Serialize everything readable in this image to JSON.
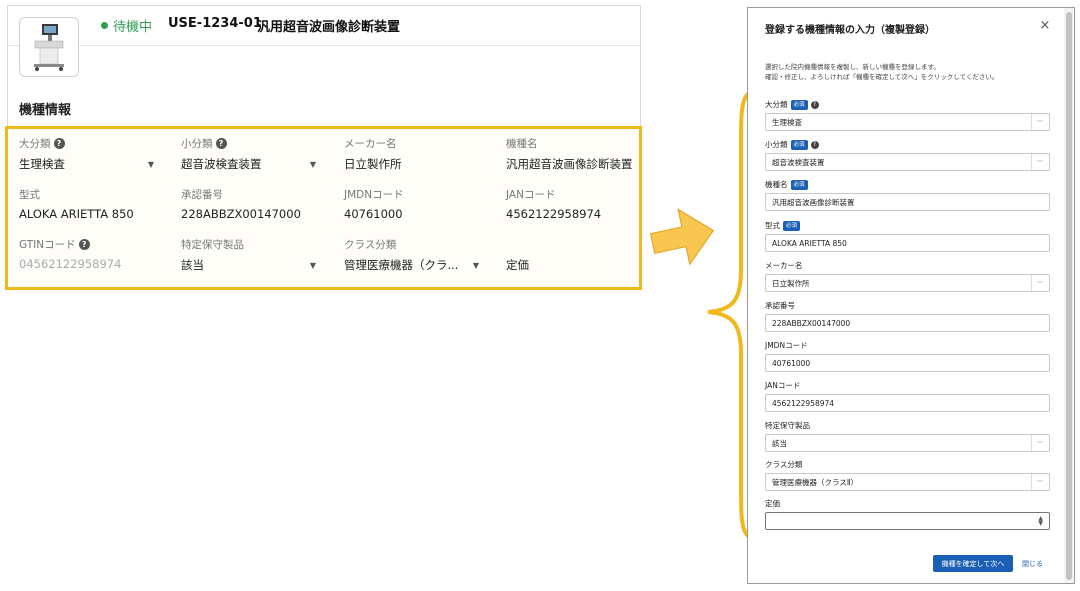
{
  "left": {
    "status": "待機中",
    "device_code": "USE-1234-01",
    "device_name": "汎用超音波画像診断装置",
    "section_title": "機種情報",
    "fields": {
      "major": {
        "label": "大分類",
        "value": "生理検査"
      },
      "minor": {
        "label": "小分類",
        "value": "超音波検査装置"
      },
      "maker": {
        "label": "メーカー名",
        "value": "日立製作所"
      },
      "model_name": {
        "label": "機種名",
        "value": "汎用超音波画像診断装置"
      },
      "model_type": {
        "label": "型式",
        "value": "ALOKA ARIETTA 850"
      },
      "approval": {
        "label": "承認番号",
        "value": "228ABBZX00147000"
      },
      "jmdn": {
        "label": "JMDNコード",
        "value": "40761000"
      },
      "jan": {
        "label": "JANコード",
        "value": "4562122958974"
      },
      "gtin": {
        "label": "GTINコード",
        "value": "04562122958974"
      },
      "maintenance": {
        "label": "特定保守製品",
        "value": "該当"
      },
      "class": {
        "label": "クラス分類",
        "value": "管理医療機器（クラ..."
      },
      "price": {
        "label": "定価",
        "value": ""
      }
    }
  },
  "dialog": {
    "title": "登録する機種情報の入力（複製登録）",
    "close_icon": "×",
    "description_1": "選択した院内機種情報を複製し、新しい機種を登録します。",
    "description_2": "確認・修正し、よろしければ「機種を確定して次へ」をクリックしてください。",
    "required_badge": "必須",
    "fields": {
      "major": {
        "label": "大分類",
        "value": "生理検査"
      },
      "minor": {
        "label": "小分類",
        "value": "超音波検査装置"
      },
      "model_name": {
        "label": "機種名",
        "value": "汎用超音波画像診断装置"
      },
      "model_type": {
        "label": "型式",
        "value": "ALOKA ARIETTA 850"
      },
      "maker": {
        "label": "メーカー名",
        "value": "日立製作所"
      },
      "approval": {
        "label": "承認番号",
        "value": "228ABBZX00147000"
      },
      "jmdn": {
        "label": "JMDNコード",
        "value": "40761000"
      },
      "jan": {
        "label": "JANコード",
        "value": "4562122958974"
      },
      "maintenance": {
        "label": "特定保守製品",
        "value": "該当"
      },
      "class": {
        "label": "クラス分類",
        "value": "管理医療機器（クラスⅡ）"
      },
      "price": {
        "label": "定価",
        "value": ""
      }
    },
    "confirm_label": "機種を確定して次へ",
    "close_label": "閉じる"
  },
  "colors": {
    "highlight": "#f1b81c",
    "status_green": "#2e9e4d",
    "primary_blue": "#1a5fb4"
  },
  "icons": {
    "help": "question-circle-icon",
    "dropdown": "chevron-down-icon",
    "arrow": "right-arrow-icon",
    "brace": "curly-brace-icon"
  }
}
